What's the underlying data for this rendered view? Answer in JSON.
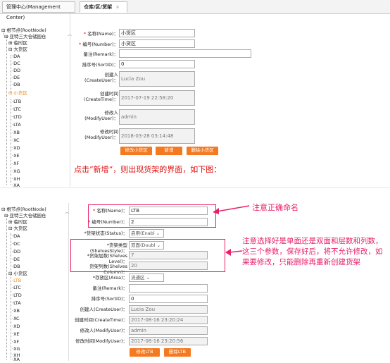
{
  "tabs": {
    "management_center": "管理中心(Management Center)",
    "warehouse_area_shelf": "仓库/区/货架",
    "close_glyph": "×"
  },
  "tree_top": {
    "root": "根节点(RootNode)",
    "park": "亚特三大仓储园仓",
    "temp_area": "临时区",
    "big_area": "大货区",
    "da": "DA",
    "dc": "DC",
    "dd": "DD",
    "de": "DE",
    "db": "DB",
    "small_area": "小货区",
    "ltb": "LTB",
    "ltc": "LTC",
    "ltd": "LTD",
    "lta": "LTA",
    "xb": "XB",
    "xc": "XC",
    "xd": "XD",
    "xe": "XE",
    "xf": "XF",
    "xg": "XG",
    "xh": "XH",
    "xa": "XA"
  },
  "form_top": {
    "name_label": "名称(Name)",
    "name_value": "小货区",
    "number_label": "编号(Number)",
    "number_value": "小货区",
    "remark_label": "备注(Remark)",
    "remark_value": "",
    "sort_label": "排序号(SortID)",
    "sort_value": "0",
    "create_user_label": "创建人",
    "create_user_label2": "(CreateUser)",
    "create_user_value": "Lucia Zou",
    "create_time_label": "创建时间",
    "create_time_label2": "(CreateTime)",
    "create_time_value": "2017-07-19 22:58:20",
    "modify_user_label": "修改人",
    "modify_user_label2": "(ModifyUser)",
    "modify_user_value": "admin",
    "modify_time_label": "修改时间",
    "modify_time_label2": "(ModifyUser)",
    "modify_time_value": "2018-03-28 03:14:48",
    "btn_modify": "修改小货区",
    "btn_add": "新增",
    "btn_delete": "删除小货区",
    "colon": "："
  },
  "instruction": "点击”新增“，则出现货架的界面，如下图：",
  "tree_bottom": {
    "root": "根节点(RootNode)",
    "park": "亚特三大仓储园仓",
    "temp_area": "临时区",
    "big_area": "大货区",
    "da": "DA",
    "dc": "DC",
    "dd": "DD",
    "de": "DE",
    "db": "DB",
    "small_area": "小货区",
    "ltb": "LTB",
    "ltc": "LTC",
    "ltd": "LTD",
    "lta": "LTA",
    "xb": "XB",
    "xc": "XC",
    "xd": "XD",
    "xe": "XE",
    "xf": "XF",
    "xg": "XG",
    "xh": "XH",
    "xa": "XA"
  },
  "form_bottom": {
    "name_label": "名称(Name)",
    "name_value": "LTB",
    "number_label": "编号(Number)",
    "number_value": "2",
    "status_label": "*货架状态(Status)",
    "status_value": "启用(Enabl",
    "style_label": "*货架类型(ShelvesStyle)",
    "style_value": "双面(Doubl",
    "level_label": "*货架层数(Shelves Level)",
    "level_value": "7",
    "column_label": "货架列数(Shelves Column)",
    "column_value": "20",
    "area_label": "*存放区(Area)",
    "area_value": "流通区",
    "remark_label": "备注(Remark)",
    "remark_value": "",
    "sort_label": "排序号(SortID)",
    "sort_value": "0",
    "create_user_label": "创建人(CreateUser)",
    "create_user_value": "Lucia Zou",
    "create_time_label": "创建时间(CreateTime)",
    "create_time_value": "2017-08-16 23:20:24",
    "modify_user_label": "修改人(ModifyUser)",
    "modify_user_value": "admin",
    "modify_time_label": "修改时间(ModifyUser)",
    "modify_time_value": "2017-08-16 23:20:56",
    "btn_modify": "修改LTB",
    "btn_delete": "删除LTB",
    "colon": "："
  },
  "notes": {
    "name_note": "注意正确命名",
    "shelf_note": "注意选择好是单面还是双面和层数和列数，这三个参数，保存好后，将不允许修改，如果要修改，只能删除再重新创建货架"
  },
  "colors": {
    "accent_orange": "#f47920",
    "note_pink": "#e8206a",
    "instruction_red": "#e01010"
  }
}
